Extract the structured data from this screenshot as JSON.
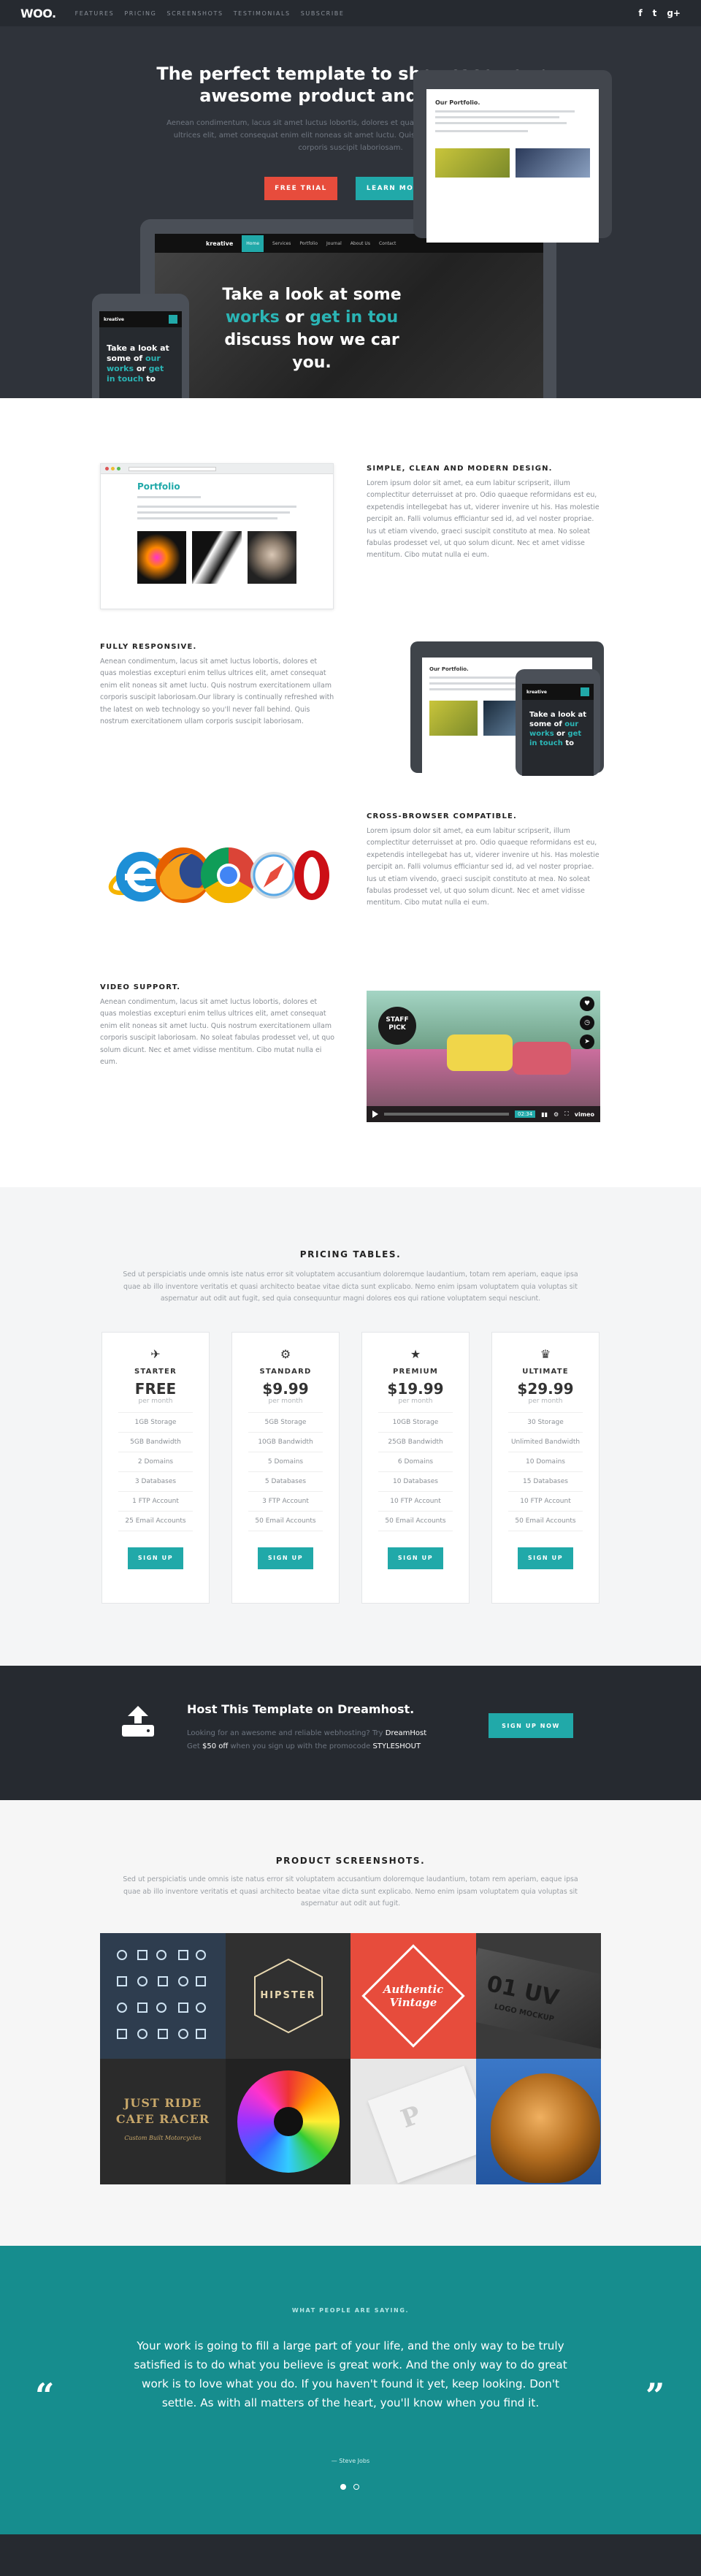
{
  "nav": {
    "logo": "WOO.",
    "items": [
      "FEATURES",
      "PRICING",
      "SCREENSHOTS",
      "TESTIMONIALS",
      "SUBSCRIBE"
    ],
    "social": [
      "f",
      "t",
      "g+"
    ]
  },
  "hero": {
    "title_line1": "The perfect template to showcase your",
    "title_line2": "awesome product and service.",
    "subtitle": "Aenean condimentum, lacus sit amet luctus lobortis, dolores et quas molestias excepturi enim tellus ultrices elit, amet consequat enim elit noneas sit amet luctu. Quis nostrum exercitationem ullam corporis suscipit laboriosam.",
    "btn_trial": "FREE TRIAL",
    "btn_learn": "LEARN MORE",
    "laptop": {
      "brand": "kreative",
      "menu": [
        "Home",
        "Services",
        "Portfolio",
        "Journal",
        "About Us",
        "Contact"
      ],
      "headline_a": "Take a look at some",
      "headline_b1": "works",
      "headline_b2": " or ",
      "headline_b3": "get in tou",
      "headline_c": "discuss how we car",
      "headline_d": "you."
    },
    "tablet": {
      "title": "Our Portfolio."
    },
    "phone": {
      "brand": "kreative",
      "l1": "Take a look at",
      "l2": "some of ",
      "l2b": "our",
      "l3": "works",
      "l3b": " or ",
      "l3c": "get",
      "l4": "in touch",
      "l4b": " to"
    }
  },
  "features": [
    {
      "title": "SIMPLE, CLEAN AND MODERN DESIGN.",
      "text": "Lorem ipsum dolor sit amet, ea eum labitur scripserit, illum complectitur deterruisset at pro. Odio quaeque reformidans est eu, expetendis intellegebat has ut, viderer invenire ut his. Has molestie percipit an. Falli volumus efficiantur sed id, ad vel noster propriae. Ius ut etiam vivendo, graeci suscipit constituto at mea. No soleat fabulas prodesset vel, ut quo solum dicunt. Nec et amet vidisse mentitum. Cibo mutat nulla ei eum."
    },
    {
      "title": "FULLY RESPONSIVE.",
      "text": "Aenean condimentum, lacus sit amet luctus lobortis, dolores et quas molestias excepturi enim tellus ultrices elit, amet consequat enim elit noneas sit amet luctu. Quis nostrum exercitationem ullam corporis suscipit laboriosam.Our library is continually refreshed with the latest on web technology so you'll never fall behind. Quis nostrum exercitationem ullam corporis suscipit laboriosam."
    },
    {
      "title": "CROSS-BROWSER COMPATIBLE.",
      "text": "Lorem ipsum dolor sit amet, ea eum labitur scripserit, illum complectitur deterruisset at pro. Odio quaeque reformidans est eu, expetendis intellegebat has ut, viderer invenire ut his. Has molestie percipit an. Falli volumus efficiantur sed id, ad vel noster propriae. Ius ut etiam vivendo, graeci suscipit constituto at mea. No soleat fabulas prodesset vel, ut quo solum dicunt. Nec et amet vidisse mentitum. Cibo mutat nulla ei eum."
    },
    {
      "title": "VIDEO SUPPORT.",
      "text": "Aenean condimentum, lacus sit amet luctus lobortis, dolores et quas molestias excepturi enim tellus ultrices elit, amet consequat enim elit noneas sit amet luctu. Quis nostrum exercitationem ullam corporis suscipit laboriosam. No soleat fabulas prodesset vel, ut quo solum dicunt. Nec et amet vidisse mentitum. Cibo mutat nulla ei eum."
    }
  ],
  "feature_shot": {
    "title": "Portfolio"
  },
  "video": {
    "badge_l1": "STAFF",
    "badge_l2": "PICK",
    "time": "02:34",
    "brand": "vimeo"
  },
  "pricing": {
    "title": "PRICING TABLES.",
    "desc": "Sed ut perspiciatis unde omnis iste natus error sit voluptatem accusantium doloremque laudantium, totam rem aperiam, eaque ipsa quae ab illo inventore veritatis et quasi architecto beatae vitae dicta sunt explicabo. Nemo enim ipsam voluptatem quia voluptas sit aspernatur aut odit aut fugit, sed quia consequuntur magni dolores eos qui ratione voluptatem sequi nesciunt.",
    "plans": [
      {
        "icon": "✈",
        "name": "STARTER",
        "price": "FREE",
        "per": "per month",
        "features": [
          "1GB Storage",
          "5GB Bandwidth",
          "2 Domains",
          "3 Databases",
          "1 FTP Account",
          "25 Email Accounts"
        ],
        "cta": "SIGN UP"
      },
      {
        "icon": "⚙",
        "name": "STANDARD",
        "price": "$9.99",
        "per": "per month",
        "features": [
          "5GB Storage",
          "10GB Bandwidth",
          "5 Domains",
          "5 Databases",
          "3 FTP Account",
          "50 Email Accounts"
        ],
        "cta": "SIGN UP"
      },
      {
        "icon": "★",
        "name": "PREMIUM",
        "price": "$19.99",
        "per": "per month",
        "features": [
          "10GB Storage",
          "25GB Bandwidth",
          "6 Domains",
          "10 Databases",
          "10 FTP Account",
          "50 Email Accounts"
        ],
        "cta": "SIGN UP"
      },
      {
        "icon": "♛",
        "name": "ULTIMATE",
        "price": "$29.99",
        "per": "per month",
        "features": [
          "30 Storage",
          "Unlimited Bandwidth",
          "10 Domains",
          "15 Databases",
          "10 FTP Account",
          "50 Email Accounts"
        ],
        "cta": "SIGN UP"
      }
    ]
  },
  "dreamhost": {
    "title": "Host This Template on Dreamhost.",
    "text1": "Looking for an awesome and reliable webhosting? Try ",
    "brand": "DreamHost",
    "text2": "Get ",
    "discount": "$50 off",
    "text3": " when you sign up with the promocode ",
    "code": "STYLESHOUT",
    "cta": "SIGN UP NOW"
  },
  "screenshots": {
    "title": "PRODUCT SCREENSHOTS.",
    "desc": "Sed ut perspiciatis unde omnis iste natus error sit voluptatem accusantium doloremque laudantium, totam rem aperiam, eaque ipsa quae ab illo inventore veritatis et quasi architecto beatae vitae dicta sunt explicabo. Nemo enim ipsam voluptatem quia voluptas sit aspernatur aut odit aut fugit.",
    "hipster": "HIPSTER",
    "authentic_l1": "Authentic",
    "authentic_l2": "Vintage",
    "uv": "01 UV",
    "uv_sub": "LOGO MOCKUP",
    "ride_l1": "JUST RIDE",
    "ride_l2": "CAFE RACER",
    "ride_sub": "Custom Built Motorcycles",
    "emboss": "P"
  },
  "testimonials": {
    "label": "WHAT PEOPLE ARE SAYING.",
    "quote": "Your work is going to fill a large part of your life, and the only way to be truly satisfied is to do what you believe is great work. And the only way to do great work is to love what you do. If you haven't found it yet, keep looking. Don't settle. As with all matters of the heart, you'll know when you find it.",
    "author": "— Steve Jobs",
    "open_mark": "“",
    "close_mark": "”"
  },
  "colors": {
    "accent": "#21a9a9",
    "red": "#e74c3c",
    "dark": "#262a30",
    "teal_bg": "#168d8e"
  }
}
